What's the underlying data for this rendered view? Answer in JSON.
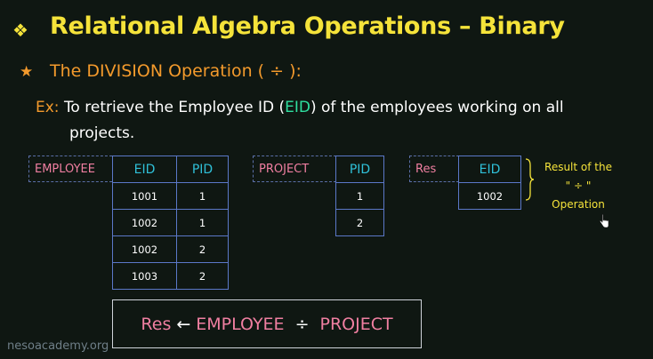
{
  "title": {
    "bullet": "❖",
    "text": "Relational Algebra Operations – Binary"
  },
  "subtitle": {
    "bullet": "★",
    "text": "The DIVISION Operation ( ÷ ):"
  },
  "example": {
    "label": "Ex:",
    "text_before": "To retrieve the Employee ID (",
    "highlight": "EID",
    "text_after": ") of the employees working on all",
    "line2": "projects."
  },
  "employee": {
    "name": "EMPLOYEE",
    "columns": [
      "EID",
      "PID"
    ],
    "rows": [
      [
        "1001",
        "1"
      ],
      [
        "1002",
        "1"
      ],
      [
        "1002",
        "2"
      ],
      [
        "1003",
        "2"
      ]
    ]
  },
  "project": {
    "name": "PROJECT",
    "columns": [
      "PID"
    ],
    "rows": [
      [
        "1"
      ],
      [
        "2"
      ]
    ]
  },
  "result": {
    "name": "Res",
    "columns": [
      "EID"
    ],
    "rows": [
      [
        "1002"
      ]
    ]
  },
  "result_note": {
    "line1": "Result of the",
    "line2": "\" ÷ \"",
    "line3": "Operation"
  },
  "formula": {
    "lhs": "Res",
    "arrow": "←",
    "left_rel": "EMPLOYEE",
    "op": "÷",
    "right_rel": "PROJECT"
  },
  "watermark": "nesoacademy.org",
  "colors": {
    "background": "#0f1712",
    "title": "#f5e33a",
    "subtitle": "#f39a2c",
    "relation_name": "#f07fa1",
    "column_header": "#2fc0d8",
    "table_border": "#5b78c8",
    "highlight": "#2fe0a0"
  }
}
